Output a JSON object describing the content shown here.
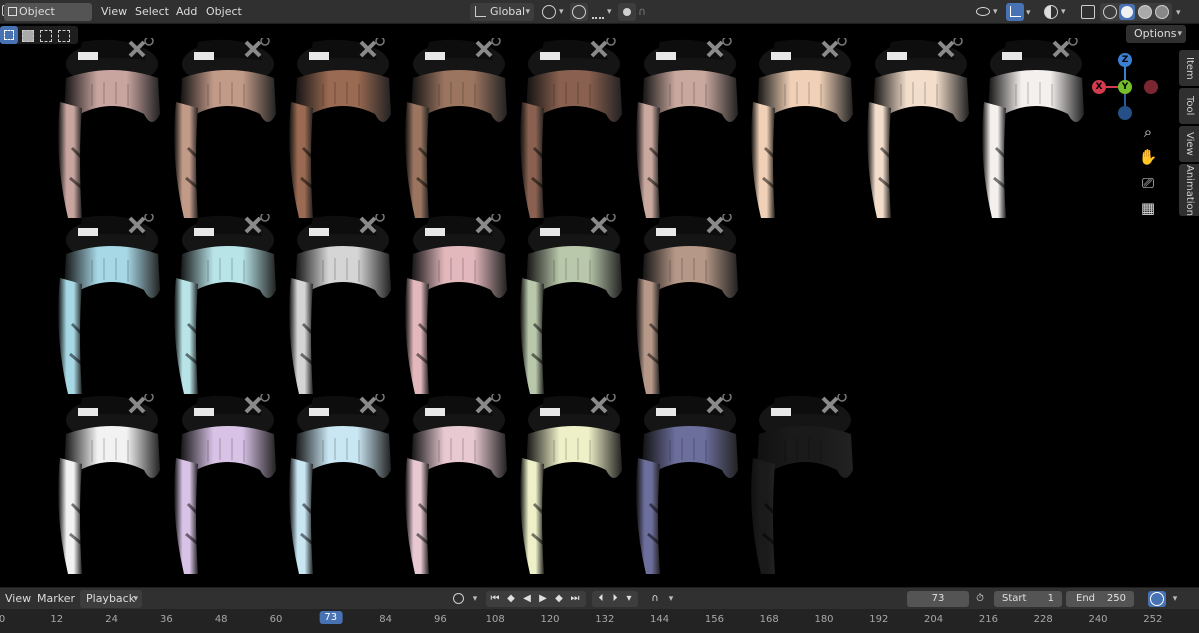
{
  "header": {
    "mode": "Object Mode",
    "menus": [
      "View",
      "Select",
      "Add",
      "Object"
    ],
    "transform_orientation": "Global",
    "options_label": "Options"
  },
  "sidebar_tabs": [
    "Item",
    "Tool",
    "View",
    "Animation"
  ],
  "gizmo": {
    "z": "Z",
    "y": "Y",
    "x": "X"
  },
  "nav_icons": [
    "zoom-icon",
    "hand-pan-icon",
    "camera-icon",
    "grid-icon"
  ],
  "viewport": {
    "rows": [
      [
        "#c9a5a0",
        "#c29a88",
        "#9a6a52",
        "#9c7560",
        "#8a6150",
        "#c9a89e",
        "#f0d0b6",
        "#f3ddcb",
        "#f4f0ee"
      ],
      [
        "#a7d8e6",
        "#b8e4e8",
        "#d5d5d5",
        "#e3b8bd",
        "#b9c8ab",
        "#b69888"
      ],
      [
        "#f2f2f2",
        "#d8c2e6",
        "#c9e6f3",
        "#e8c9d2",
        "#eef0c8",
        "#6c6e9c",
        "#1a1a1a"
      ]
    ]
  },
  "timeline": {
    "menus": [
      "View",
      "Marker",
      "Playback"
    ],
    "current_frame": "73",
    "start_label": "Start",
    "start_value": "1",
    "end_label": "End",
    "end_value": "250",
    "ruler": [
      "0",
      "12",
      "24",
      "36",
      "48",
      "60",
      "73",
      "84",
      "96",
      "108",
      "120",
      "132",
      "144",
      "156",
      "168",
      "180",
      "192",
      "204",
      "216",
      "228",
      "240",
      "252"
    ],
    "highlight_color": "#4772b3"
  }
}
